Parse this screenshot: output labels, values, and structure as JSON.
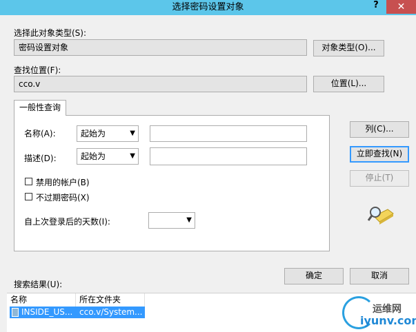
{
  "window": {
    "title": "选择密码设置对象",
    "help_label": "?",
    "close_label": "✕"
  },
  "object_type": {
    "label": "选择此对象类型(S):",
    "value": "密码设置对象",
    "button": "对象类型(O)..."
  },
  "location": {
    "label": "查找位置(F):",
    "value": "cco.v",
    "button": "位置(L)..."
  },
  "tab": {
    "label": "一般性查询"
  },
  "query": {
    "name_label": "名称(A):",
    "name_match": "起始为",
    "name_value": "",
    "desc_label": "描述(D):",
    "desc_match": "起始为",
    "desc_value": "",
    "disabled_accounts_label": "禁用的帐户(B)",
    "non_expiring_label": "不过期密码(X)",
    "days_label": "自上次登录后的天数(I):",
    "days_value": ""
  },
  "side_buttons": {
    "columns": "列(C)...",
    "find_now": "立即查找(N)",
    "stop": "停止(T)"
  },
  "actions": {
    "ok": "确定",
    "cancel": "取消"
  },
  "results": {
    "label": "搜索结果(U):",
    "columns": [
      "名称",
      "所在文件夹"
    ],
    "rows": [
      {
        "name": "INSIDE_US...",
        "folder": "cco.v/System..."
      }
    ]
  },
  "watermark": {
    "top": "运维网",
    "bottom": "iyunv.com"
  },
  "icons": {
    "search_illustration": "magnifier-folder-icon",
    "dropdown_arrow": "chevron-down-icon",
    "result_object": "object-icon"
  },
  "colors": {
    "titlebar": "#5cc6ea",
    "close": "#c75050",
    "selection": "#3399ff"
  }
}
